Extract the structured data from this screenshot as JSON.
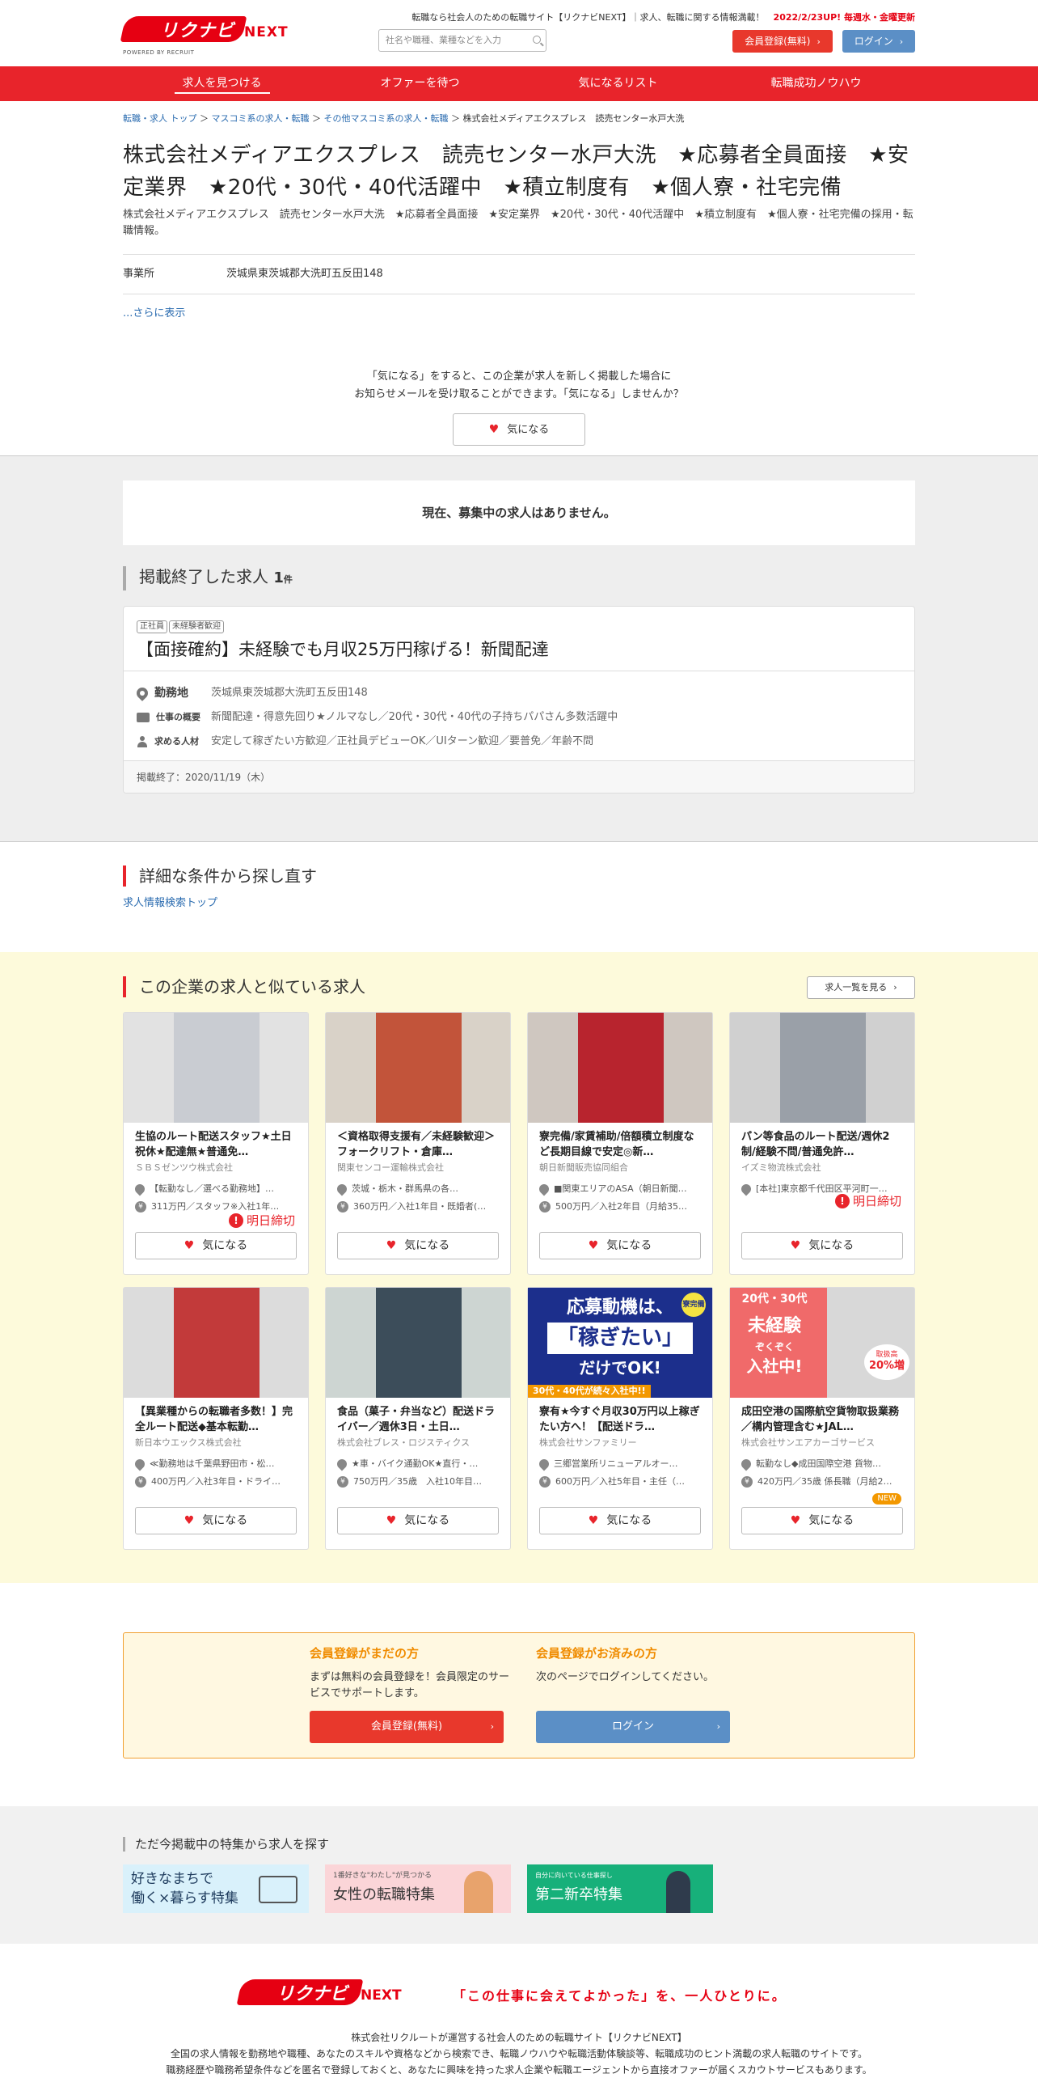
{
  "header": {
    "logo_text": "リクナビ",
    "logo_next": "NEXT",
    "logo_sub": "POWERED BY RECRUIT",
    "tagline_main": "転職なら社会人のための転職サイト【リクナビNEXT】｜求人、転職に関する情報満載！",
    "tagline_hl": "2022/2/23UP! 毎週水・金曜更新",
    "search_placeholder": "社名や職種、業種などを入力",
    "register_label": "会員登録(無料)",
    "login_label": "ログイン"
  },
  "nav": [
    "求人を見つける",
    "オファーを待つ",
    "気になるリスト",
    "転職成功ノウハウ"
  ],
  "breadcrumb": {
    "items": [
      "転職・求人 トップ",
      "マスコミ系の求人・転職",
      "その他マスコミ系の求人・転職"
    ],
    "current": "株式会社メディアエクスプレス　読売センター水戸大洗",
    "sep": "＞"
  },
  "company": {
    "title": "株式会社メディアエクスプレス　読売センター水戸大洗　★応募者全員面接　★安定業界　★20代・30代・40代活躍中　★積立制度有　★個人寮・社宅完備",
    "subdesc": "株式会社メディアエクスプレス　読売センター水戸大洗　★応募者全員面接　★安定業界　★20代・30代・40代活躍中　★積立制度有　★個人寮・社宅完備の採用・転職情報。",
    "office_label": "事業所",
    "office_value": "茨城県東茨城郡大洗町五反田148",
    "more_label": "...さらに表示"
  },
  "fav": {
    "msg1": "「気になる」をすると、この企業が求人を新しく掲載した場合に",
    "msg2": "お知らせメールを受け取ることができます。「気になる」しませんか？",
    "button": "気になる"
  },
  "no_job": "現在、募集中の求人はありません。",
  "ended": {
    "heading": "掲載終了した求人",
    "count": "1",
    "unit": "件",
    "tags": [
      "正社員",
      "未経験者歓迎"
    ],
    "title": "【面接確約】未経験でも月収25万円稼げる！新聞配達",
    "rows": [
      {
        "k": "勤務地",
        "v": "茨城県東茨城郡大洗町五反田148"
      },
      {
        "k": "仕事の概要",
        "v": "新聞配達・得意先回り★ノルマなし／20代・30代・40代の子持ちパパさん多数活躍中"
      },
      {
        "k": "求める人材",
        "v": "安定して稼ぎたい方歓迎／正社員デビューOK／UIターン歓迎／要普免／年齢不問"
      }
    ],
    "footer": "掲載終了：2020/11/19（木）"
  },
  "refine": {
    "heading": "詳細な条件から探し直す",
    "link": "求人情報検索トップ"
  },
  "similar": {
    "heading": "この企業の求人と似ている求人",
    "list_all": "求人一覧を見る",
    "fav_label": "気になる",
    "deadline_label": "明日締切",
    "new_label": "NEW",
    "cards": [
      {
        "title": "生協のルート配送スタッフ★土日祝休★配達無★普通免…",
        "company": "ＳＢＳゼンツウ株式会社",
        "loc": "【転勤なし／選べる勤務地】…",
        "sal": "311万円／スタッフ※入社1年…",
        "deadline": true,
        "new": false
      },
      {
        "title": "＜資格取得支援有／未経験歓迎＞フォークリフト・倉庫…",
        "company": "関東センコー運輸株式会社",
        "loc": "茨城・栃木・群馬県の各…",
        "sal": "360万円／入社1年目・既婚者(…",
        "deadline": false,
        "new": false
      },
      {
        "title": "寮完備/家賃補助/倍額積立制度など長期目線で安定◎新…",
        "company": "朝日新聞販売協同組合",
        "loc": "■関東エリアのASA（朝日新聞…",
        "sal": "500万円／入社2年目（月給35…",
        "deadline": false,
        "new": false
      },
      {
        "title": "パン等食品のルート配送/週休2制/経験不問/普通免許…",
        "company": "イズミ物流株式会社",
        "loc": "[本社]東京都千代田区平河町一…",
        "sal": "",
        "deadline": true,
        "new": false
      },
      {
        "title": "【異業種からの転職者多数！】完全ルート配送◆基本転勤…",
        "company": "新日本ウエックス株式会社",
        "loc": "≪勤務地は千葉県野田市・松…",
        "sal": "400万円／入社3年目・ドライ…",
        "deadline": false,
        "new": false
      },
      {
        "title": "食品（菓子・弁当など）配送ドライバー／週休3日・土日…",
        "company": "株式会社ブレス・ロジスティクス",
        "loc": "★車・バイク通勤OK★直行・…",
        "sal": "750万円／35歳　入社10年目…",
        "deadline": false,
        "new": false
      },
      {
        "title": "寮有★今すぐ月収30万円以上稼ぎたい方へ！【配送ドラ…",
        "company": "株式会社サンファミリー",
        "loc": "三郷営業所リニューアルオー…",
        "sal": "600万円／入社5年目・主任（…",
        "deadline": false,
        "new": false
      },
      {
        "title": "成田空港の国際航空貨物取扱業務／構内管理含む★JAL…",
        "company": "株式会社サンエアカーゴサービス",
        "loc": "転勤なし◆成田国際空港 貨物…",
        "sal": "420万円／35歳 係長職（月給2…",
        "deadline": false,
        "new": true
      }
    ],
    "banner_texts": {
      "b7_main": "応募動機は、",
      "b7_big": "「稼ぎたい」",
      "b7_sub": "だけでOK!",
      "b7_foot": "30代・40代が続々入社中!!",
      "b7_badge": "寮完備",
      "b8_top": "20代・30代",
      "b8_main": "未経験",
      "b8_mid": "ぞくぞく",
      "b8_bot": "入社中!",
      "b8_rate": "取扱高",
      "b8_pct": "20%増"
    }
  },
  "member": {
    "left_h": "会員登録がまだの方",
    "left_t": "まずは無料の会員登録を！会員限定のサービスでサポートします。",
    "left_btn": "会員登録(無料)",
    "right_h": "会員登録がお済みの方",
    "right_t": "次のページでログインしてください。",
    "right_btn": "ログイン"
  },
  "feature": {
    "heading": "ただ今掲載中の特集から求人を探す",
    "b1_l1": "好きなまちで",
    "b1_l2": "働く×暮らす特集",
    "b2_top": "1番好きな\"わたし\"が見つかる",
    "b2_main": "女性の転職特集",
    "b3_top": "自分に向いている仕事探し",
    "b3_main": "第二新卒特集"
  },
  "footer": {
    "logo_text": "リクナビ",
    "logo_next": "NEXT",
    "slogan": "「この仕事に会えてよかった」を、一人ひとりに。",
    "l1": "株式会社リクルートが運営する社会人のための転職サイト【リクナビNEXT】",
    "l2": "全国の求人情報を勤務地や職種、あなたのスキルや資格などから検索でき、転職ノウハウや転職活動体験談等、転職成功のヒント満載の求人転職のサイトです。",
    "l3": "職務経歴や職務希望条件などを匿名で登録しておくと、あなたに興味を持った求人企業や転職エージェントから直接オファーが届くスカウトサービスもあります。"
  }
}
